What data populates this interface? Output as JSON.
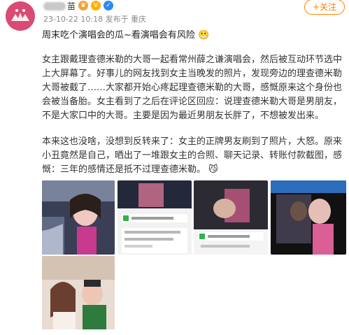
{
  "post": {
    "author_suffix": "苗",
    "timestamp": "23-10-22 10:18",
    "posted_from": "发布于 重庆",
    "follow_label": "+关注",
    "title": "周末吃个演唱会的瓜~看演唱会有风险",
    "paragraph1": "女主跟戴理查德米勒的大哥一起看常州薛之谦演唱会，然后被互动环节选中上大屏幕了。好事儿的网友找到女主当晚发的照片，发现旁边的理查德米勒大哥被截了……大家都开始心疼起理查德米勒的大哥，感慨原来这个身份也会被当备胎。女主看到了之后在评论区回应：说理查德米勒大哥是男朋友，不是大家口中的大哥。主要是因为最近男朋友长胖了，不想被发出来。",
    "paragraph2": "本来这也没啥，没想到反转来了：女主的正牌男友刷到了照片，大怒。原来小丑竟然是自己，晒出了一堆跟女主的合照、聊天记录、转账付款截图，感慨：三年的感情还是抵不过理查德米勒。",
    "paragraph2_emoji": "😼"
  },
  "images": [
    {
      "name": "photo-1"
    },
    {
      "name": "photo-2"
    },
    {
      "name": "photo-3"
    },
    {
      "name": "photo-4"
    },
    {
      "name": "photo-5"
    }
  ],
  "colors": {
    "accent": "#ff8200",
    "meta_gray": "#8a8a8a",
    "avatar_pink": "#d94b74"
  },
  "icons": {
    "avatar_icon": "avatar-icon",
    "crown_badge": "crown-icon",
    "vip_badge": "vip-icon",
    "verify_badge": "verified-icon"
  }
}
